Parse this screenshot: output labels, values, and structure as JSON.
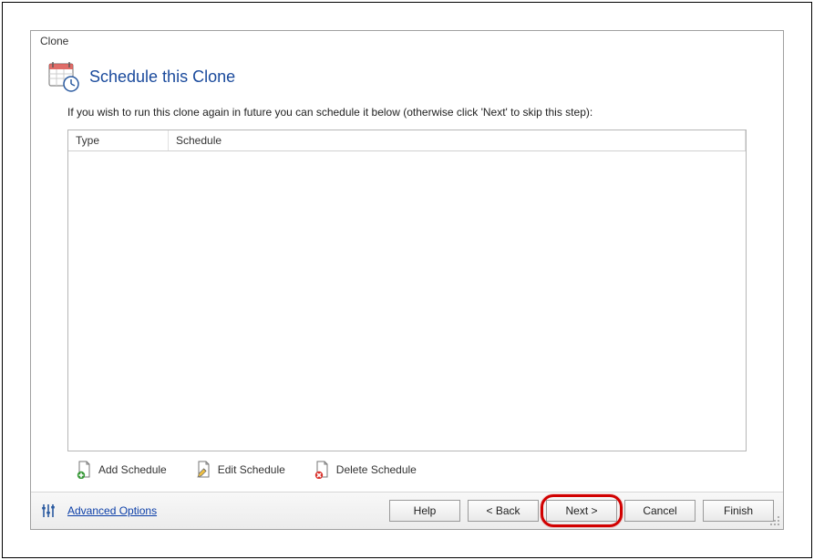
{
  "window": {
    "title": "Clone"
  },
  "header": {
    "title": "Schedule this Clone"
  },
  "description": "If you wish to run this clone again in future you can schedule it below (otherwise click 'Next' to skip this step):",
  "list": {
    "columns": {
      "type": "Type",
      "schedule": "Schedule"
    },
    "rows": []
  },
  "actions": {
    "add": "Add Schedule",
    "edit": "Edit Schedule",
    "delete": "Delete Schedule"
  },
  "footer": {
    "advanced": "Advanced Options",
    "help": "Help",
    "back": "< Back",
    "next": "Next >",
    "cancel": "Cancel",
    "finish": "Finish"
  }
}
